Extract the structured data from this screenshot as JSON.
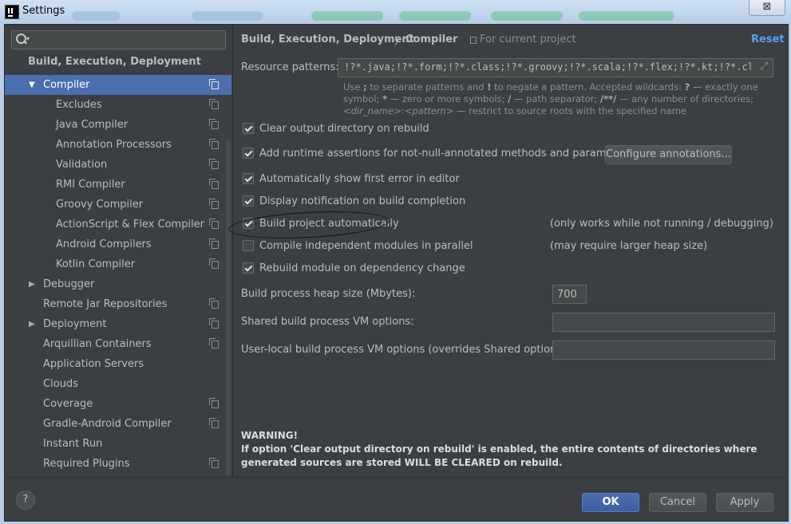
{
  "window": {
    "title": "Settings",
    "close_glyph": "⊠"
  },
  "sidebar": {
    "search_placeholder": "",
    "section_header": "Build, Execution, Deployment",
    "items": [
      {
        "label": "Compiler",
        "expanded": true,
        "selected": true
      },
      {
        "label": "Excludes"
      },
      {
        "label": "Java Compiler"
      },
      {
        "label": "Annotation Processors"
      },
      {
        "label": "Validation"
      },
      {
        "label": "RMI Compiler"
      },
      {
        "label": "Groovy Compiler"
      },
      {
        "label": "ActionScript & Flex Compiler"
      },
      {
        "label": "Android Compilers"
      },
      {
        "label": "Kotlin Compiler"
      },
      {
        "label": "Debugger",
        "collapsed": true
      },
      {
        "label": "Remote Jar Repositories"
      },
      {
        "label": "Deployment",
        "collapsed": true
      },
      {
        "label": "Arquillian Containers"
      },
      {
        "label": "Application Servers"
      },
      {
        "label": "Clouds"
      },
      {
        "label": "Coverage"
      },
      {
        "label": "Gradle-Android Compiler"
      },
      {
        "label": "Instant Run"
      },
      {
        "label": "Required Plugins"
      }
    ],
    "arrows": {
      "expanded": "▼",
      "collapsed": "▶"
    }
  },
  "header": {
    "breadcrumb_parent": "Build, Execution, Deployment",
    "breadcrumb_sep": "〉",
    "breadcrumb_current": "Compiler",
    "scope_text": "For current project",
    "reset_label": "Reset"
  },
  "resource_patterns": {
    "label": "Resource patterns:",
    "value": "!?*.java;!?*.form;!?*.class;!?*.groovy;!?*.scala;!?*.flex;!?*.kt;!?*.clj;!?*.aj",
    "expand_glyph": "⤢",
    "help": {
      "p1": "Use ",
      "s1": ";",
      "p2": " to separate patterns and ",
      "s2": "!",
      "p3": " to negate a pattern. Accepted wildcards: ",
      "s3": "?",
      "p4": " — exactly one symbol; ",
      "s4": "*",
      "p5": " — zero or more symbols; ",
      "s5": "/",
      "p6": " — path separator; ",
      "s6": "/**/",
      "p7": " — any number of directories; ",
      "i1": "<dir_name>",
      "p8": ":",
      "i2": "<pattern>",
      "p9": " — restrict to source roots with the specified name"
    }
  },
  "options": [
    {
      "label": "Clear output directory on rebuild",
      "checked": true
    },
    {
      "label": "Add runtime assertions for not-null-annotated methods and parameters",
      "checked": true
    },
    {
      "label": "Automatically show first error in editor",
      "checked": true
    },
    {
      "label": "Display notification on build completion",
      "checked": true
    },
    {
      "label": "Build project automatically",
      "checked": true,
      "note": "(only works while not running / debugging)"
    },
    {
      "label": "Compile independent modules in parallel",
      "checked": false,
      "note": "(may require larger heap size)"
    },
    {
      "label": "Rebuild module on dependency change",
      "checked": true
    }
  ],
  "configure_annotations_label": "Configure annotations...",
  "heap": {
    "label": "Build process heap size (Mbytes):",
    "value": "700"
  },
  "shared_vm": {
    "label": "Shared build process VM options:",
    "value": ""
  },
  "user_vm": {
    "label": "User-local build process VM options (overrides Shared options):",
    "value": ""
  },
  "warning": {
    "title": "WARNING!",
    "text": "If option 'Clear output directory on rebuild' is enabled, the entire contents of directories where generated sources are stored WILL BE CLEARED on rebuild."
  },
  "footer": {
    "help_label": "?",
    "ok_label": "OK",
    "cancel_label": "Cancel",
    "apply_label": "Apply"
  },
  "colors": {
    "background": "#3c3f41",
    "selection": "#4b6eaf",
    "link": "#589df6",
    "primary_button": "#4b6fb0"
  }
}
